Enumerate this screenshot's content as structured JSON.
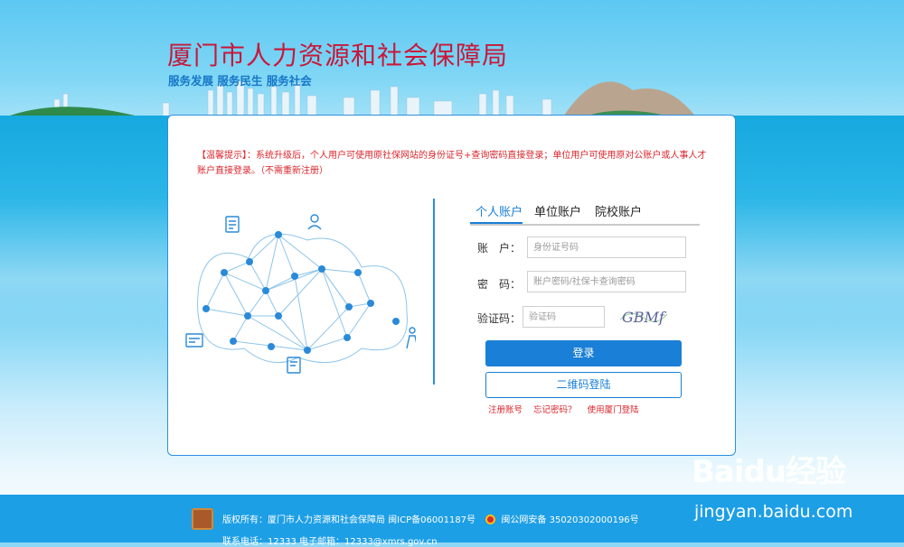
{
  "header": {
    "title": "厦门市人力资源和社会保障局",
    "slogan": "服务发展 服务民生 服务社会"
  },
  "notice": "【温馨提示】：系统升级后，个人用户可使用原社保网站的身份证号+查询密码直接登录；单位用户可使用原对公账户或人事人才账户直接登录。（不需重新注册）",
  "tabs": [
    {
      "label": "个人账户",
      "active": true
    },
    {
      "label": "单位账户",
      "active": false
    },
    {
      "label": "院校账户",
      "active": false
    }
  ],
  "form": {
    "account_label": "账　户：",
    "account_placeholder": "身份证号码",
    "password_label": "密　码：",
    "password_placeholder": "账户密码/社保卡查询密码",
    "captcha_label": "验证码：",
    "captcha_placeholder": "验证码",
    "captcha_text": "GBMf",
    "login_button": "登录",
    "qr_button": "二维码登陆"
  },
  "links": [
    "注册账号",
    "忘记密码？",
    "使用厦门登陆"
  ],
  "footer": {
    "copyright": "版权所有：厦门市人力资源和社会保障局 闽ICP备06001187号",
    "police": "闽公网安备 35020302000196号",
    "contact": "联系电话：12333 电子邮箱：12333@xmrs.gov.cn"
  },
  "watermark": {
    "brand": "Baidu经验",
    "url": "jingyan.baidu.com"
  },
  "colors": {
    "brand_red": "#c8183a",
    "primary_blue": "#1a7fd6",
    "footer_blue": "#1d9fe6"
  }
}
